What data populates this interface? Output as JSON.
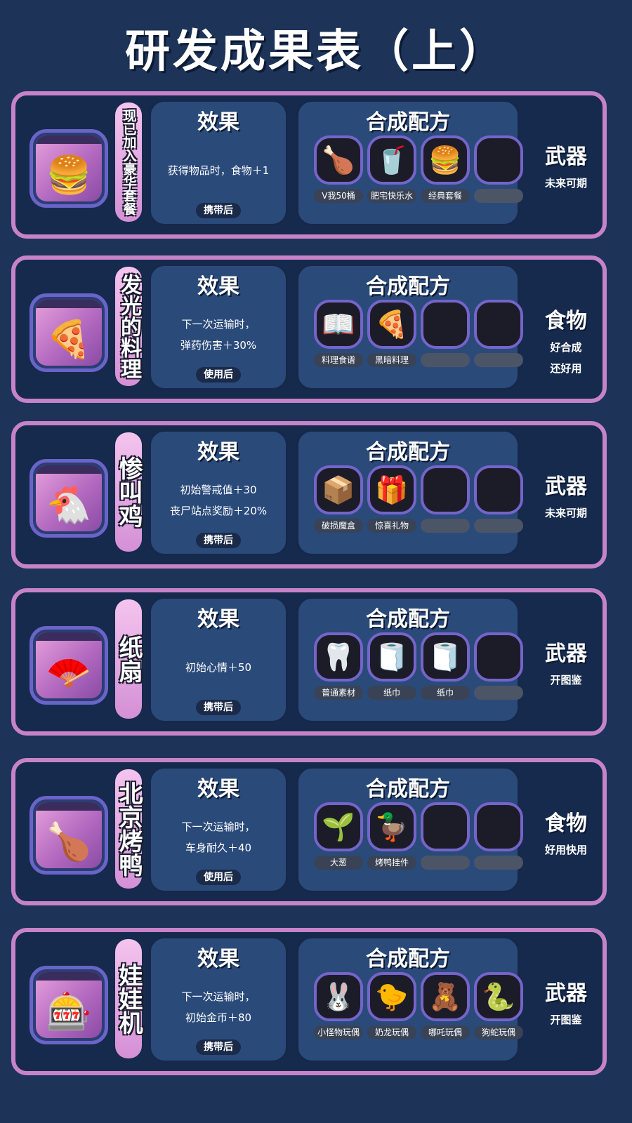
{
  "page": {
    "title": "研发成果表（上）"
  },
  "labels": {
    "effect_header": "效果",
    "recipe_header": "合成配方"
  },
  "cards": [
    {
      "name": "现已加入豪华套餐",
      "item_icon": "burger-combo-icon",
      "effect_lines": [
        "获得物品时，食物＋1"
      ],
      "timing": "携带后",
      "recipe": [
        {
          "label": "V我50桶",
          "icon": "fried-chicken-bucket-icon"
        },
        {
          "label": "肥宅快乐水",
          "icon": "cola-bottle-icon"
        },
        {
          "label": "经典套餐",
          "icon": "burger-combo-icon"
        },
        {
          "label": "",
          "icon": ""
        }
      ],
      "category": "武器",
      "remarks": [
        "未来可期"
      ]
    },
    {
      "name": "发光的料理",
      "item_icon": "glowing-dish-icon",
      "effect_lines": [
        "下一次运输时，",
        "弹药伤害＋30%"
      ],
      "timing": "使用后",
      "recipe": [
        {
          "label": "料理食谱",
          "icon": "recipe-book-icon"
        },
        {
          "label": "黑暗料理",
          "icon": "dark-dish-icon"
        },
        {
          "label": "",
          "icon": ""
        },
        {
          "label": "",
          "icon": ""
        }
      ],
      "category": "食物",
      "remarks": [
        "好合成",
        "还好用"
      ]
    },
    {
      "name": "惨叫鸡",
      "item_icon": "rubber-chicken-icon",
      "effect_lines": [
        "初始警戒值＋30",
        "丧尸站点奖励＋20%"
      ],
      "timing": "携带后",
      "recipe": [
        {
          "label": "破损魔盒",
          "icon": "broken-box-icon"
        },
        {
          "label": "惊喜礼物",
          "icon": "gift-box-icon"
        },
        {
          "label": "",
          "icon": ""
        },
        {
          "label": "",
          "icon": ""
        }
      ],
      "category": "武器",
      "remarks": [
        "未来可期"
      ]
    },
    {
      "name": "纸扇",
      "item_icon": "paper-fan-icon",
      "effect_lines": [
        "初始心情＋50"
      ],
      "timing": "携带后",
      "recipe": [
        {
          "label": "普通素材",
          "icon": "horn-material-icon"
        },
        {
          "label": "纸巾",
          "icon": "tissue-box-icon"
        },
        {
          "label": "纸巾",
          "icon": "tissue-box-icon"
        },
        {
          "label": "",
          "icon": ""
        }
      ],
      "category": "武器",
      "remarks": [
        "开图鉴"
      ]
    },
    {
      "name": "北京烤鸭",
      "item_icon": "roast-duck-icon",
      "effect_lines": [
        "下一次运输时，",
        "车身耐久＋40"
      ],
      "timing": "使用后",
      "recipe": [
        {
          "label": "大葱",
          "icon": "green-onion-icon"
        },
        {
          "label": "烤鸭挂件",
          "icon": "duck-pendant-icon"
        },
        {
          "label": "",
          "icon": ""
        },
        {
          "label": "",
          "icon": ""
        }
      ],
      "category": "食物",
      "remarks": [
        "好用快用"
      ]
    },
    {
      "name": "娃娃机",
      "item_icon": "claw-machine-icon",
      "effect_lines": [
        "下一次运输时，",
        "初始金币＋80"
      ],
      "timing": "携带后",
      "recipe": [
        {
          "label": "小怪物玩偶",
          "icon": "monster-doll-icon"
        },
        {
          "label": "奶龙玩偶",
          "icon": "yellow-dragon-doll-icon"
        },
        {
          "label": "哪吒玩偶",
          "icon": "nezha-doll-icon"
        },
        {
          "label": "狗蛇玩偶",
          "icon": "dog-snake-doll-icon"
        }
      ],
      "category": "武器",
      "remarks": [
        "开图鉴"
      ]
    }
  ]
}
